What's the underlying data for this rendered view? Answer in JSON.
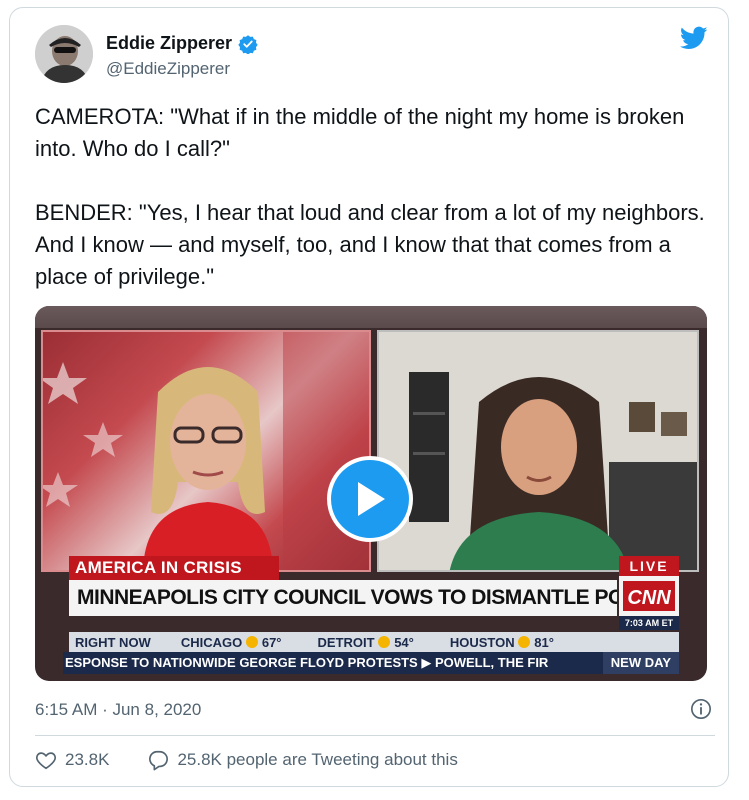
{
  "user": {
    "display_name": "Eddie Zipperer",
    "handle": "@EddieZipperer"
  },
  "tweet": {
    "text": "CAMEROTA: \"What if in the middle of the night my home is broken into. Who do I call?\"\n\nBENDER: \"Yes, I hear that loud and clear from a lot of my neighbors. And I know — and myself, too, and I know that that comes from a place of privilege.\"",
    "timestamp": "6:15 AM · Jun 8, 2020"
  },
  "video": {
    "banner": "AMERICA IN CRISIS",
    "live_label": "LIVE",
    "headline": "MINNEAPOLIS CITY COUNCIL VOWS TO DISMANTLE POLICE DEPT.",
    "network": "CNN",
    "time": "7:03 AM ET",
    "weather": {
      "right_now": "RIGHT NOW",
      "cities": [
        {
          "name": "CHICAGO",
          "temp": "67°"
        },
        {
          "name": "DETROIT",
          "temp": "54°"
        },
        {
          "name": "HOUSTON",
          "temp": "81°"
        }
      ]
    },
    "ticker": "ESPONSE TO NATIONWIDE GEORGE FLOYD PROTESTS  ▶  POWELL, THE FIR",
    "show": "NEW DAY"
  },
  "actions": {
    "likes": "23.8K",
    "tweeting": "25.8K people are Tweeting about this"
  },
  "colors": {
    "twitter_blue": "#1d9bf0",
    "cnn_red": "#c0161d",
    "text_secondary": "#536471"
  }
}
